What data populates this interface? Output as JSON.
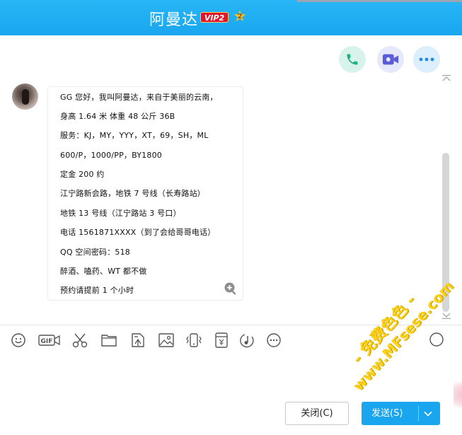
{
  "header": {
    "contact_name": "阿曼达",
    "vip_label": "VIP2",
    "level": "2"
  },
  "actions": {
    "phone": "phone-call-icon",
    "video": "video-call-icon",
    "more": "more-icon"
  },
  "message": {
    "lines": [
      "GG 您好，我叫阿曼达，来自于美丽的云南，",
      "身高 1.64 米 体重 48 公斤 36B",
      "服务：KJ，MY，YYY，XT，69，SH，ML",
      "600/P，1000/PP，BY1800",
      "定金 200 约",
      "江宁路新会路，地铁 7 号线（长寿路站）",
      "地铁 13 号线（江宁路站 3 号口）",
      "电话 1561871XXXX（到了会给哥哥电话）",
      "QQ 空间密码：518",
      "醉酒、嗑药、WT 都不做",
      "预约请提前 1 个小时"
    ]
  },
  "toolbar": [
    "emoji-icon",
    "gif-icon",
    "scissors-icon",
    "folder-icon",
    "doc-send-icon",
    "image-icon",
    "shake-icon",
    "red-packet-icon",
    "music-icon",
    "more-options-icon"
  ],
  "watermark": {
    "line1": "- 免费色色 -",
    "line2": "www.MFsese.com"
  },
  "buttons": {
    "close": "关闭(C)",
    "send": "发送(S)"
  },
  "colors": {
    "header": "#1aa6ef",
    "send": "#1aa6ef",
    "vip": "#e0172a"
  }
}
